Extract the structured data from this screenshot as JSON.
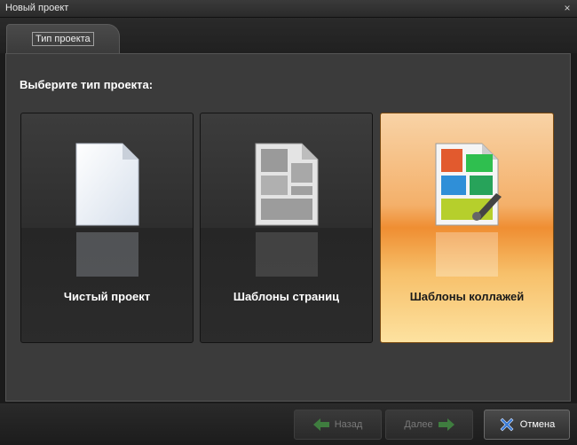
{
  "window": {
    "title": "Новый проект",
    "close_glyph": "×"
  },
  "tabs": [
    {
      "label": "Тип проекта"
    }
  ],
  "main": {
    "prompt": "Выберите тип проекта:",
    "cards": [
      {
        "label": "Чистый проект",
        "icon": "blank-page-icon",
        "selected": false
      },
      {
        "label": "Шаблоны страниц",
        "icon": "page-templates-icon",
        "selected": false
      },
      {
        "label": "Шаблоны коллажей",
        "icon": "collage-templates-icon",
        "selected": true
      }
    ]
  },
  "buttons": {
    "back": {
      "label": "Назад",
      "icon": "arrow-left-icon",
      "enabled": false
    },
    "next": {
      "label": "Далее",
      "icon": "arrow-right-icon",
      "enabled": false
    },
    "cancel": {
      "label": "Отмена",
      "icon": "close-x-icon",
      "enabled": true
    }
  },
  "colors": {
    "selected_card": "#f4a34a",
    "back_arrow": "#3f7d3f",
    "cancel_x": "#3a7bd5"
  }
}
